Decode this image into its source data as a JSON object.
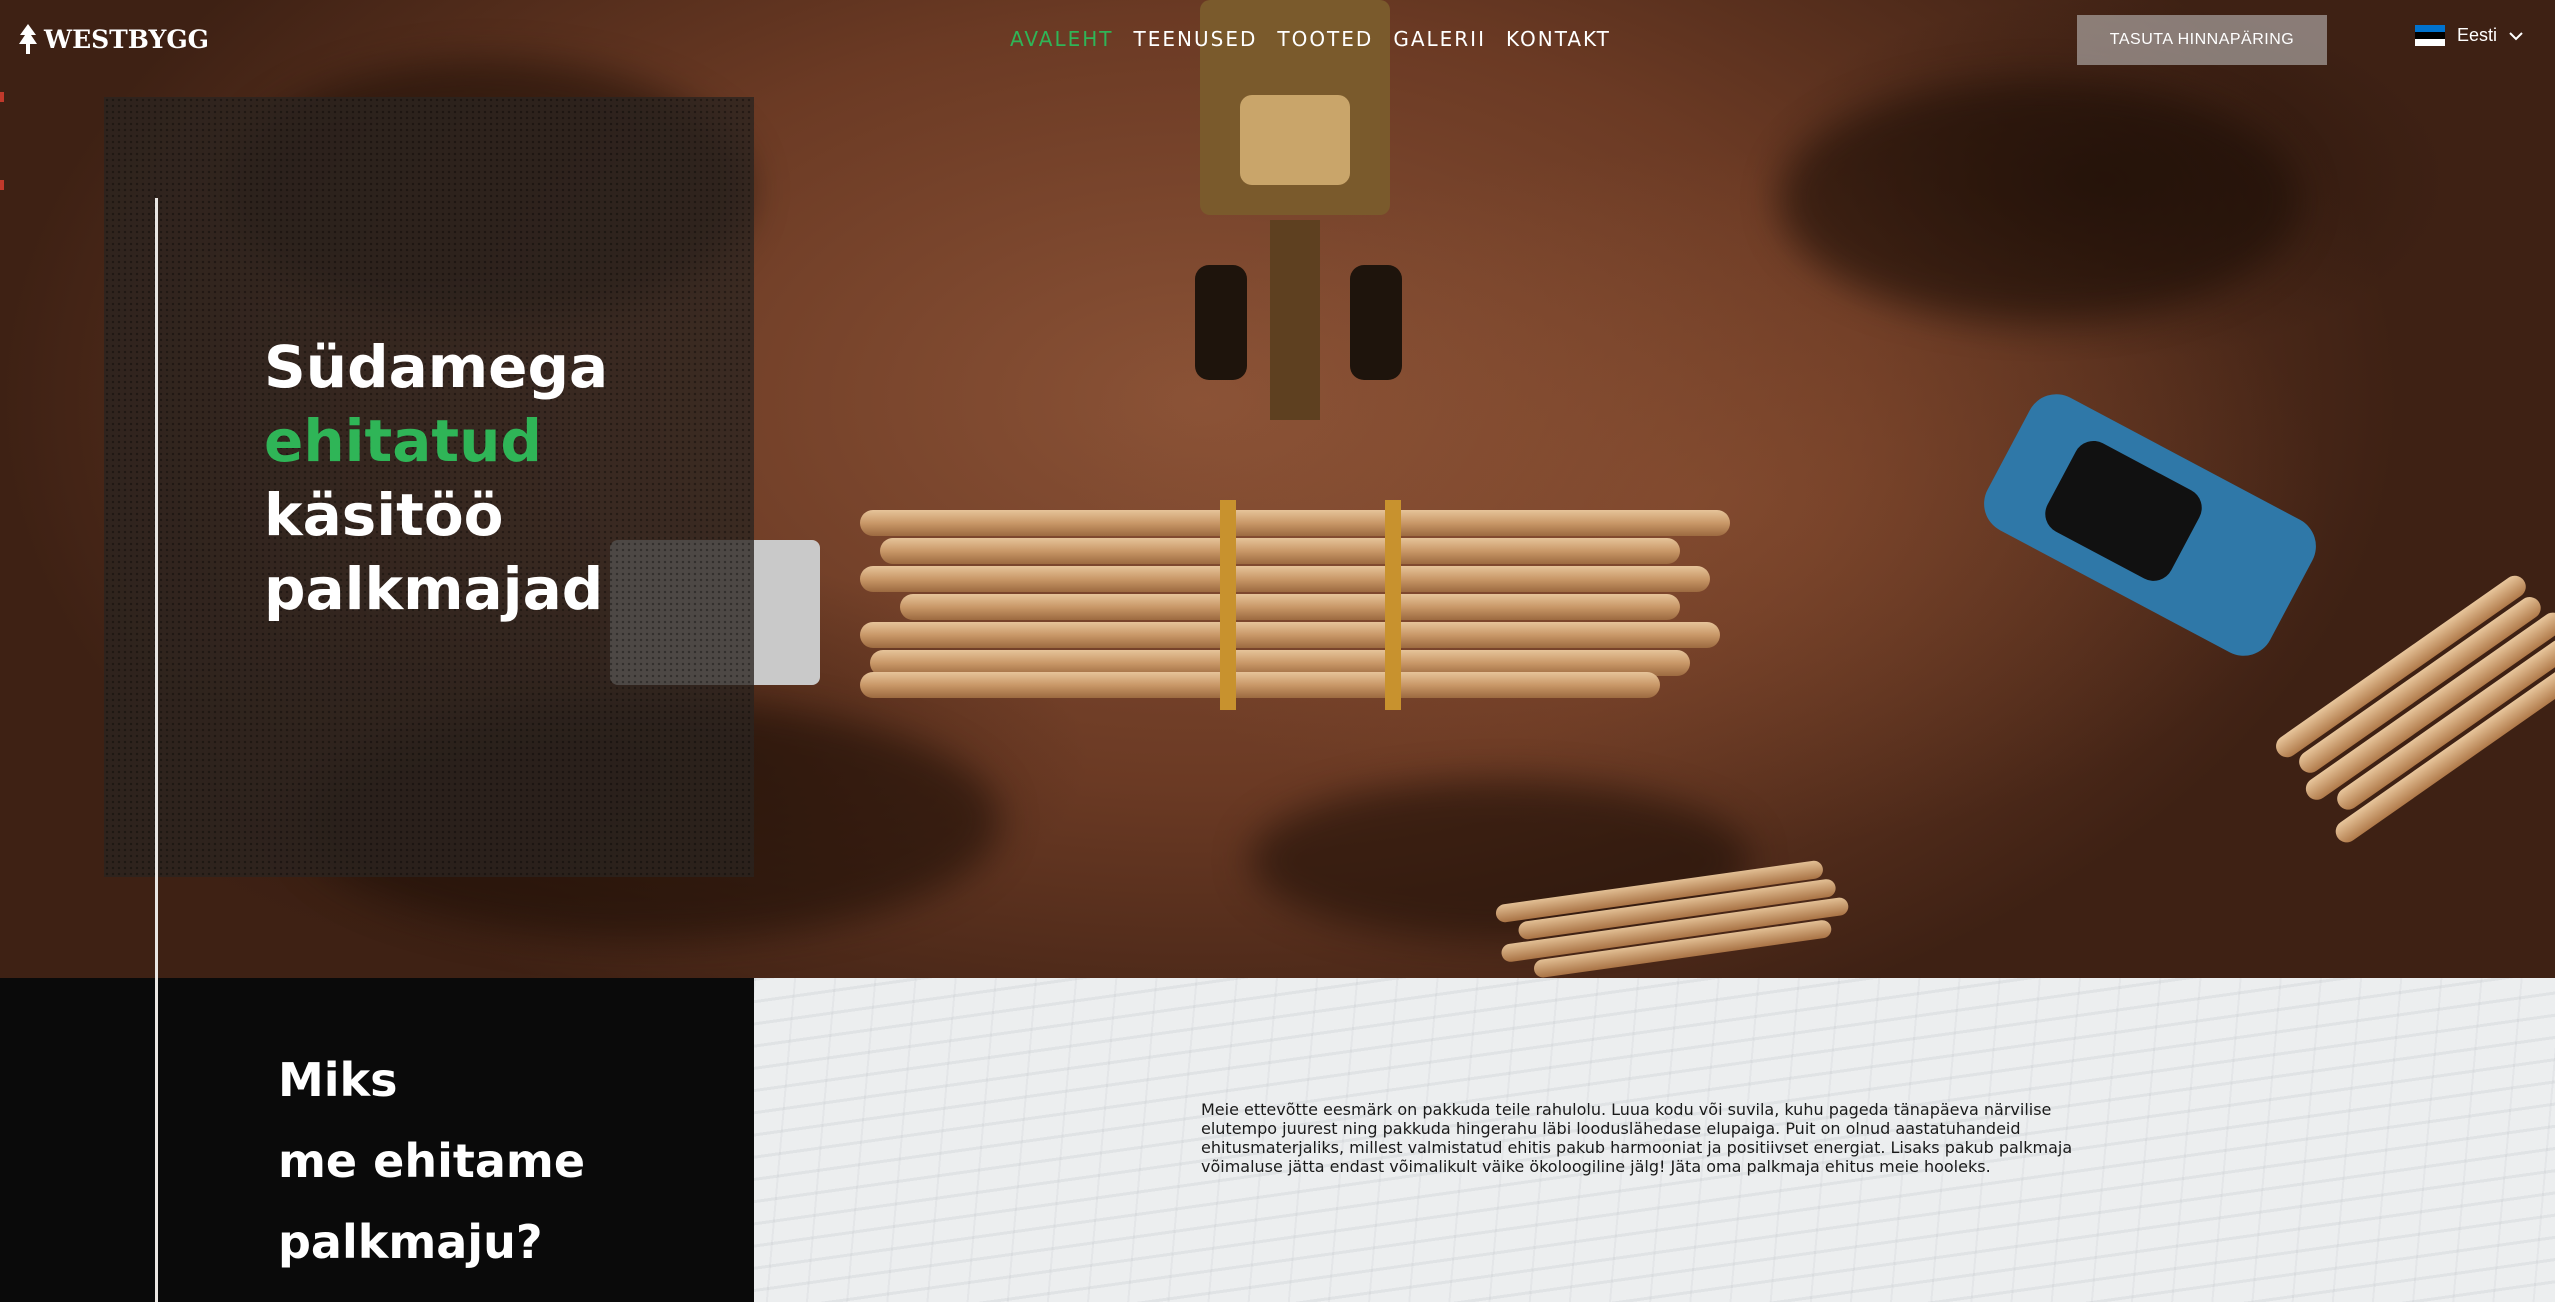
{
  "brand": {
    "name": "WESTBYGG",
    "logo_icon": "tree-icon"
  },
  "nav": {
    "items": [
      {
        "label": "AVALEHT",
        "active": true
      },
      {
        "label": "TEENUSED",
        "active": false
      },
      {
        "label": "TOOTED",
        "active": false
      },
      {
        "label": "GALERII",
        "active": false
      },
      {
        "label": "KONTAKT",
        "active": false
      }
    ]
  },
  "header": {
    "cta_label": "TASUTA HINNAPÄRING",
    "language": {
      "label": "Eesti",
      "flag": "estonia-flag-icon",
      "flag_colors": [
        "#0072ce",
        "#000000",
        "#ffffff"
      ]
    }
  },
  "hero": {
    "title_line1": "Südamega",
    "title_line2": "ehitatud",
    "title_line3": "käsitöö",
    "title_line4": "palkmajad"
  },
  "why": {
    "title_line1": "Miks",
    "title_line2": "me ehitame",
    "title_line3": "palkmaju?",
    "body": "Meie ettevõtte eesmärk on pakkuda teile rahulolu. Luua kodu või suvila, kuhu pageda tänapäeva närvilise elutempo juurest ning pakkuda hingerahu läbi looduslähedase elupaiga. Puit on olnud aastatuhandeid ehitusmaterjaliks, millest valmistatud ehitis pakub harmooniat ja positiivset energiat. Lisaks pakub palkmaja võimaluse jätta endast võimalikult väike ökoloogiline jälg! Jäta oma palkmaja ehitus meie hooleks."
  },
  "colors": {
    "accent": "#2fb557",
    "dark": "#0a0a0a",
    "light_panel": "#eceeef"
  }
}
